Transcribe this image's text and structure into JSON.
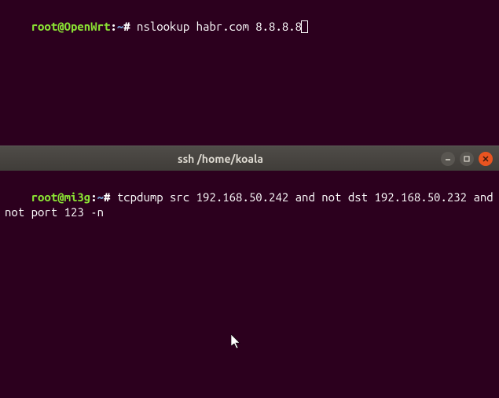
{
  "top_terminal": {
    "prompt_user": "root@OpenWrt",
    "prompt_colon": ":",
    "prompt_path": "~",
    "prompt_hash": "# ",
    "command": "nslookup habr.com 8.8.8.8"
  },
  "titlebar": {
    "title": "ssh  /home/koala"
  },
  "bottom_terminal": {
    "prompt_user": "root@mi3g",
    "prompt_colon": ":",
    "prompt_path": "~",
    "prompt_hash": "# ",
    "command": "tcpdump src 192.168.50.242 and not dst 192.168.50.232 and not port 123 -n"
  }
}
